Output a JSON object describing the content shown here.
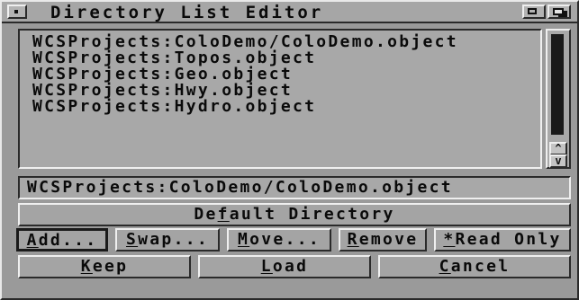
{
  "window": {
    "title": "Directory List Editor"
  },
  "list": {
    "items": [
      "WCSProjects:ColoDemo/ColoDemo.object",
      "WCSProjects:Topos.object",
      "WCSProjects:Geo.object",
      "WCSProjects:Hwy.object",
      "WCSProjects:Hydro.object"
    ],
    "selected_index": 0
  },
  "path_field": {
    "value": "WCSProjects:ColoDemo/ColoDemo.object"
  },
  "buttons": {
    "default_directory": {
      "pre": "De",
      "key": "f",
      "post": "ault Directory"
    },
    "add": {
      "key": "A",
      "post": "dd..."
    },
    "swap": {
      "key": "S",
      "post": "wap..."
    },
    "move": {
      "key": "M",
      "post": "ove..."
    },
    "remove": {
      "key": "R",
      "post": "emove"
    },
    "read_only": {
      "key": "*",
      "post": "Read Only"
    },
    "keep": {
      "key": "K",
      "post": "eep"
    },
    "load": {
      "key": "L",
      "post": "oad"
    },
    "cancel": {
      "key": "C",
      "post": "ancel"
    }
  },
  "scroll": {
    "up_arrow": "^",
    "down_arrow": "v"
  }
}
